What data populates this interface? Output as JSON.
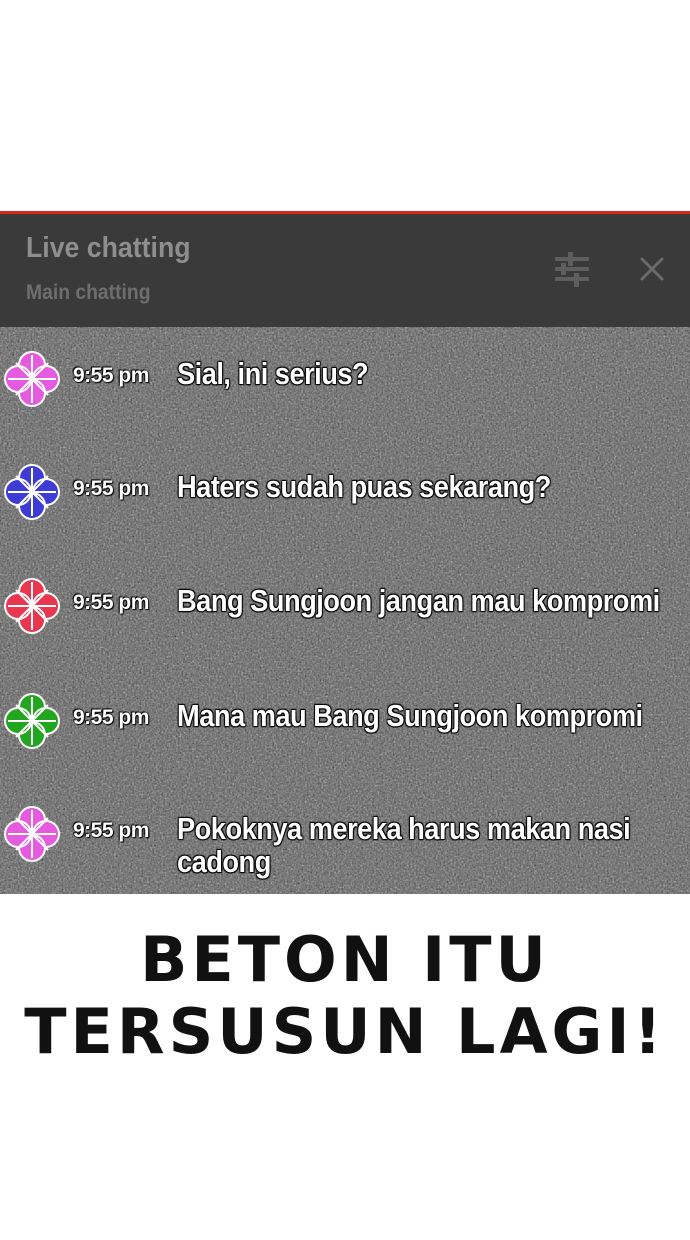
{
  "header": {
    "title": "Live chatting",
    "subtitle": "Main chatting",
    "filter_icon": "tune-sliders-icon",
    "close_icon": "close-x-icon"
  },
  "colors": {
    "accent_line": "#d9241c",
    "header_bg": "#3a3a3a",
    "chat_bg": "#555555"
  },
  "messages": [
    {
      "time": "9:55 pm",
      "text": "Sial, ini serius?",
      "avatar_color": "#e45be0",
      "avatar_icon": "flower-avatar-icon"
    },
    {
      "time": "9:55 pm",
      "text": "Haters sudah puas sekarang?",
      "avatar_color": "#3d3dd6",
      "avatar_icon": "flower-avatar-icon"
    },
    {
      "time": "9:55 pm",
      "text": "Bang Sungjoon jangan mau kompromi",
      "avatar_color": "#e8374e",
      "avatar_icon": "flower-avatar-icon"
    },
    {
      "time": "9:55 pm",
      "text": "Mana mau Bang Sungjoon kompromi",
      "avatar_color": "#22a51f",
      "avatar_icon": "flower-avatar-icon"
    },
    {
      "time": "9:55 pm",
      "text": "Pokoknya mereka harus makan nasi cadong",
      "avatar_color": "#e45be0",
      "avatar_icon": "flower-avatar-icon"
    }
  ],
  "caption": {
    "line1": "BETON ITU",
    "line2": "TERSUSUN LAGI!"
  }
}
